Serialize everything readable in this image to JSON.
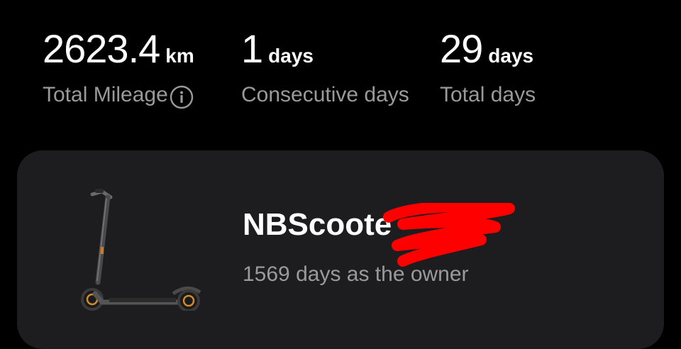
{
  "stats": {
    "mileage": {
      "value": "2623.4",
      "unit": "km",
      "label": "Total Mileage",
      "info_icon": "info-icon"
    },
    "consecutive": {
      "value": "1",
      "unit": "days",
      "label": "Consecutive days"
    },
    "total": {
      "value": "29",
      "unit": "days",
      "label": "Total days"
    }
  },
  "device_card": {
    "name": "NBScoote",
    "owner_text": "1569 days as the owner",
    "image_icon": "scooter-image",
    "redaction_color": "#ff0000"
  },
  "colors": {
    "background": "#000000",
    "card": "#1d1d1f",
    "primary_text": "#ffffff",
    "secondary_text": "#9a9a9a"
  }
}
